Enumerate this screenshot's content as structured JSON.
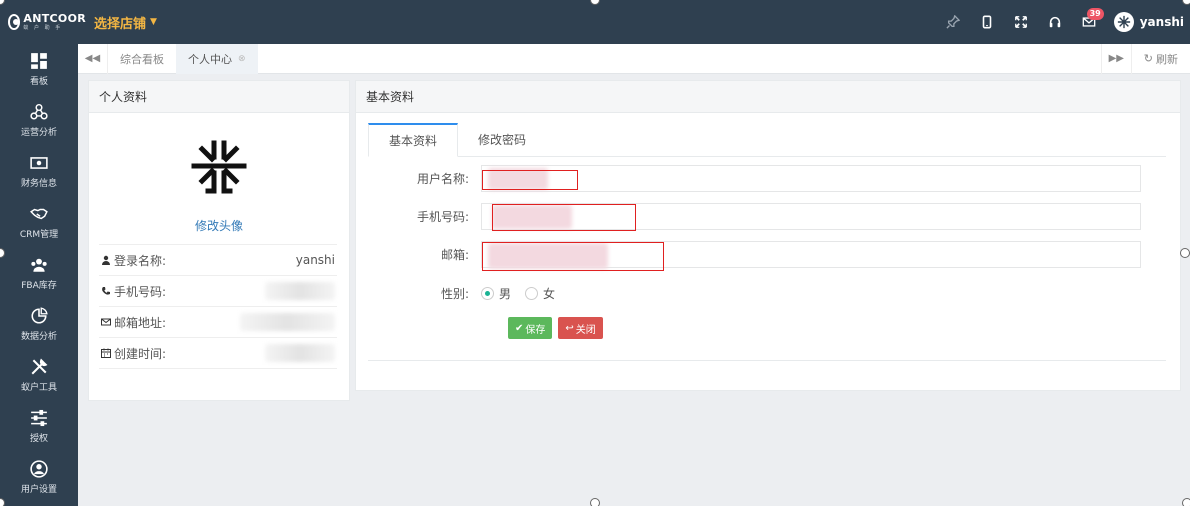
{
  "header": {
    "logo_name": "ANTCOOR",
    "logo_sub": "蚁 户 助 手",
    "store_selector": "选择店铺",
    "notification_count": "39",
    "username": "yanshi"
  },
  "sidebar": {
    "items": [
      {
        "label": "看板",
        "icon": "dashboard-icon"
      },
      {
        "label": "运营分析",
        "icon": "network-icon"
      },
      {
        "label": "财务信息",
        "icon": "money-icon"
      },
      {
        "label": "CRM管理",
        "icon": "handshake-icon"
      },
      {
        "label": "FBA库存",
        "icon": "users-icon"
      },
      {
        "label": "数据分析",
        "icon": "pie-icon"
      },
      {
        "label": "蚁户工具",
        "icon": "tools-icon"
      },
      {
        "label": "授权",
        "icon": "sliders-icon"
      },
      {
        "label": "用户设置",
        "icon": "user-circle-icon"
      }
    ]
  },
  "tabs": {
    "items": [
      {
        "label": "综合看板"
      },
      {
        "label": "个人中心"
      }
    ],
    "refresh_label": "刷新"
  },
  "profile": {
    "title": "个人资料",
    "edit_avatar": "修改头像",
    "rows": [
      {
        "label": "登录名称:",
        "value": "yanshi"
      },
      {
        "label": "手机号码:",
        "value": ""
      },
      {
        "label": "邮箱地址:",
        "value": ""
      },
      {
        "label": "创建时间:",
        "value": ""
      }
    ]
  },
  "basic": {
    "title": "基本资料",
    "tab_basic": "基本资料",
    "tab_password": "修改密码",
    "fields": {
      "username_label": "用户名称:",
      "phone_label": "手机号码:",
      "email_label": "邮箱:",
      "gender_label": "性别:"
    },
    "gender_male": "男",
    "gender_female": "女",
    "gender_selected": "男",
    "save_label": "保存",
    "close_label": "关闭"
  },
  "colors": {
    "nav_bg": "#2f4050",
    "store_accent": "#f3b643",
    "tab_accent": "#2e8ded",
    "save": "#5cb85c",
    "close": "#d9534f",
    "badge": "#ed5565"
  }
}
